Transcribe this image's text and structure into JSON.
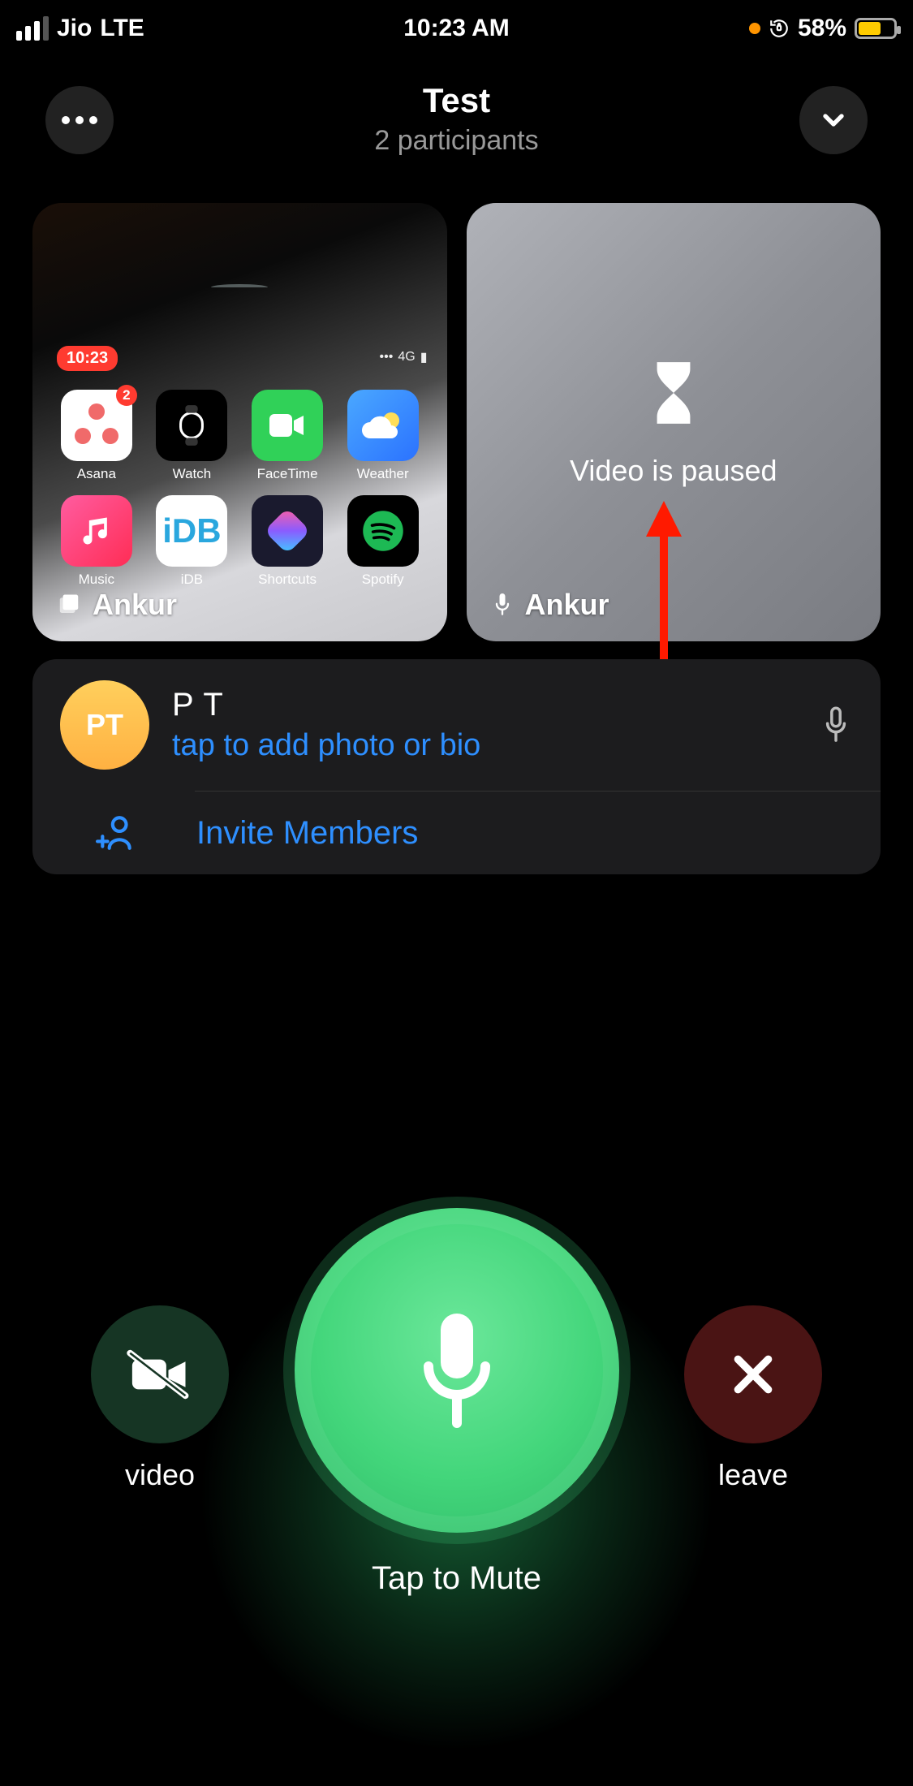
{
  "status": {
    "carrier": "Jio",
    "network": "LTE",
    "time": "10:23 AM",
    "battery_pct": "58%"
  },
  "header": {
    "title": "Test",
    "subtitle": "2 participants"
  },
  "tiles": {
    "left": {
      "name": "Ankur",
      "mini_time": "10:23",
      "mini_net": "4G",
      "apps": [
        {
          "label": "Asana",
          "badge": "2"
        },
        {
          "label": "Watch"
        },
        {
          "label": "FaceTime"
        },
        {
          "label": "Weather"
        },
        {
          "label": "Music"
        },
        {
          "label": "iDB"
        },
        {
          "label": "Shortcuts"
        },
        {
          "label": "Spotify"
        }
      ]
    },
    "right": {
      "name": "Ankur",
      "status": "Video is paused"
    }
  },
  "list": {
    "user_initials": "PT",
    "user_name": "P T",
    "user_hint": "tap to add photo or bio",
    "invite": "Invite Members"
  },
  "controls": {
    "video": "video",
    "leave": "leave",
    "mute": "Tap to Mute"
  }
}
